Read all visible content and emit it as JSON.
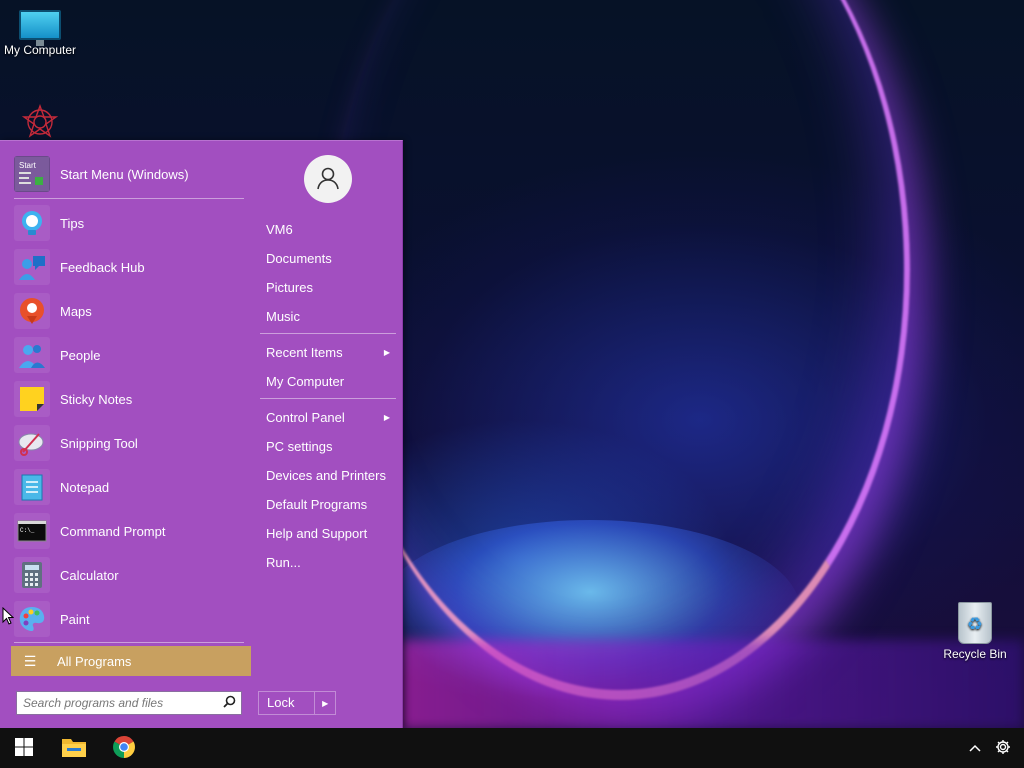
{
  "desktop": {
    "icons": [
      {
        "label": "My Computer",
        "icon": "monitor-icon"
      },
      {
        "label": "",
        "icon": "star-logo-icon"
      },
      {
        "label": "Recycle Bin",
        "icon": "recycle-bin-icon"
      }
    ]
  },
  "start_menu": {
    "pinned": [
      {
        "label": "Start Menu (Windows)",
        "icon": "start-menu-app-icon"
      },
      {
        "label": "Tips",
        "icon": "lightbulb-icon"
      },
      {
        "label": "Feedback Hub",
        "icon": "feedback-hub-icon"
      },
      {
        "label": "Maps",
        "icon": "map-pin-icon"
      },
      {
        "label": "People",
        "icon": "people-icon"
      },
      {
        "label": "Sticky Notes",
        "icon": "sticky-note-icon"
      },
      {
        "label": "Snipping Tool",
        "icon": "scissors-icon"
      },
      {
        "label": "Notepad",
        "icon": "notepad-icon"
      },
      {
        "label": "Command Prompt",
        "icon": "terminal-icon"
      },
      {
        "label": "Calculator",
        "icon": "calculator-icon"
      },
      {
        "label": "Paint",
        "icon": "paint-palette-icon"
      }
    ],
    "start_icon_text": "Start",
    "cmd_icon_text": "C:\\_",
    "all_programs_label": "All Programs",
    "search_placeholder": "Search programs and files",
    "user_avatar_icon": "user-icon",
    "right_links": [
      {
        "label": "VM6",
        "submenu": false
      },
      {
        "label": "Documents",
        "submenu": false
      },
      {
        "label": "Pictures",
        "submenu": false
      },
      {
        "label": "Music",
        "submenu": false
      },
      {
        "label": "Recent Items",
        "submenu": true
      },
      {
        "label": "My Computer",
        "submenu": false
      },
      {
        "label": "Control Panel",
        "submenu": true
      },
      {
        "label": "PC settings",
        "submenu": false
      },
      {
        "label": "Devices and Printers",
        "submenu": false
      },
      {
        "label": "Default Programs",
        "submenu": false
      },
      {
        "label": "Help and Support",
        "submenu": false
      },
      {
        "label": "Run...",
        "submenu": false
      }
    ],
    "lock_label": "Lock",
    "colors": {
      "menu_bg": "#a24fc0",
      "all_programs_bg": "#c8a060"
    }
  },
  "taskbar": {
    "items": [
      {
        "name": "start",
        "icon": "windows-logo-icon"
      },
      {
        "name": "file-explorer",
        "icon": "folder-icon"
      },
      {
        "name": "chrome",
        "icon": "chrome-icon"
      }
    ],
    "tray": [
      {
        "name": "show-hidden-icons",
        "icon": "chevron-up-icon"
      },
      {
        "name": "settings",
        "icon": "gear-icon"
      }
    ]
  }
}
